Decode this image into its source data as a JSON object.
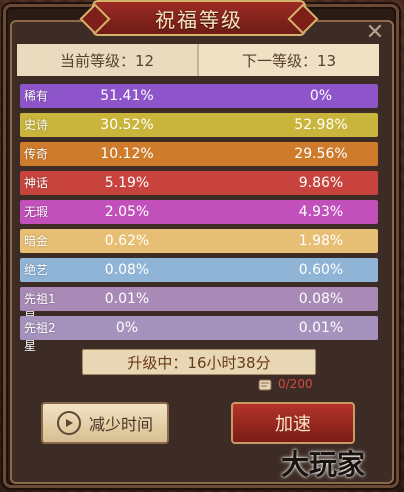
{
  "window": {
    "title": "祝福等级",
    "close_glyph": "✕"
  },
  "levels": {
    "current_label": "当前等级：12",
    "next_label": "下一等级：13"
  },
  "rarity_rows": [
    {
      "name": "稀有",
      "current": "51.41%",
      "next": "0%",
      "color": "#8d55c9"
    },
    {
      "name": "史诗",
      "current": "30.52%",
      "next": "52.98%",
      "color": "#c9b53c"
    },
    {
      "name": "传奇",
      "current": "10.12%",
      "next": "29.56%",
      "color": "#cf7b2c"
    },
    {
      "name": "神话",
      "current": "5.19%",
      "next": "9.86%",
      "color": "#c8433d"
    },
    {
      "name": "无瑕",
      "current": "2.05%",
      "next": "4.93%",
      "color": "#c250bb"
    },
    {
      "name": "暗金",
      "current": "0.62%",
      "next": "1.98%",
      "color": "#e6bf74"
    },
    {
      "name": "绝艺",
      "current": "0.08%",
      "next": "0.60%",
      "color": "#8fb4d6"
    },
    {
      "name": "先祖1星",
      "current": "0.01%",
      "next": "0.08%",
      "color": "#a98ab6"
    },
    {
      "name": "先祖2星",
      "current": "0%",
      "next": "0.01%",
      "color": "#a593bd"
    }
  ],
  "status": {
    "timer_text": "升级中：16小时38分",
    "item_count": "0/200"
  },
  "buttons": {
    "reduce_time": "减少时间",
    "speed_up": "加速"
  },
  "watermark": "大玩家"
}
